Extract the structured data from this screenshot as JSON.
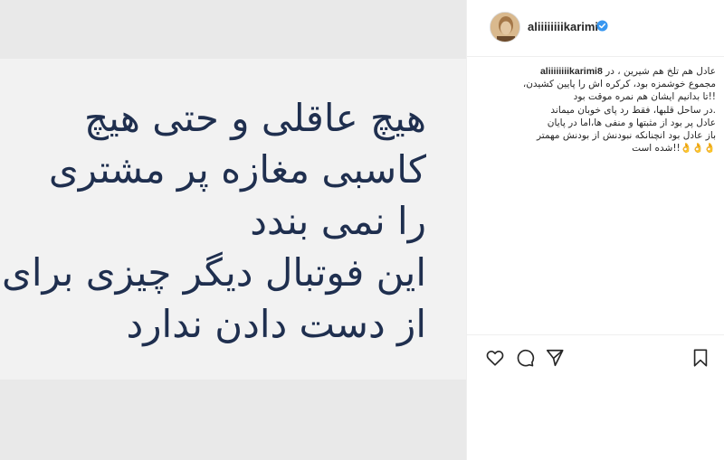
{
  "post": {
    "image_text_lines": [
      "هیچ عاقلی و حتی هیچ",
      "کاسبی مغازه پر مشتری",
      "را نمی بندد",
      "این فوتبال دیگر چیزی برای",
      "از دست دادن ندارد"
    ]
  },
  "header": {
    "username": "aliiiiiiiikarimi8"
  },
  "caption": {
    "username": "aliiiiiiiikarimi8",
    "first_line": "عادل هم تلخ هم شیرین ، در",
    "lines": [
      "مجموع خوشمزه بود، کرکره اش را پایین کشیدن،",
      "!!تا بدانیم ایشان هم نمره موقت بود",
      ".در ساحل قلبها، فقط رد پای خوبان میماند",
      "عادل پر بود از مثبتها و منفی ها،اما در پایان",
      "باز عادل بود انچنانکه نبودنش از بودنش مهمتر",
      "👌👌👌!!شده است"
    ]
  },
  "icons": {
    "avatar": "avatar",
    "verified": "verified-badge-icon",
    "like": "heart-icon",
    "comment": "comment-icon",
    "share": "share-icon",
    "save": "bookmark-icon"
  },
  "colors": {
    "image_text": "#1f2f4f",
    "verified": "#3897f0",
    "text": "#262626"
  }
}
